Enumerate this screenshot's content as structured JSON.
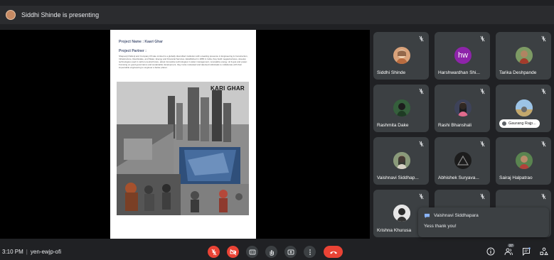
{
  "presenter_bar": {
    "text": "Siddhi Shinde is presenting"
  },
  "document": {
    "project_name": "Project Name : Kaari Ghar",
    "project_partner_heading": "Project Partner :",
    "body_text": "Shapoorji Pallonji and Company Private Limited is a globally diversified institution with a leading presence in Engineering & Construction, Infrastructure, Real Estate, and Water, Energy and Financial Services. Established in 1865 in India, they build megastructures, develop technologies used in carbon-neutral future, adopt innovative technologies in water management, renewable energy, oil & gas and power. Focusing on good governance and sustainable development, they invite motivated and talented individuals to collaborate with their impeccable engineering to engineer a better planet.",
    "collage_title": "KARI GHAR"
  },
  "participants": [
    {
      "name": "Siddhi Shinde",
      "avatar": "photo"
    },
    {
      "name": "Harshwardhan Shi...",
      "avatar": "initials",
      "initials": "hw"
    },
    {
      "name": "Tarika Deshpande",
      "avatar": "photo"
    },
    {
      "name": "Rashmita Dake",
      "avatar": "photo"
    },
    {
      "name": "Rashi Bhanshali",
      "avatar": "photo"
    },
    {
      "name": "Gaurang Rajp...",
      "avatar": "photo"
    },
    {
      "name": "Vaishnavi Siddhap...",
      "avatar": "photo"
    },
    {
      "name": "Abhishek Suryava...",
      "avatar": "icon"
    },
    {
      "name": "Sairaj Halpatrao",
      "avatar": "photo"
    },
    {
      "name": "Krishna Khurusa",
      "avatar": "photo"
    }
  ],
  "chat_toast": {
    "sender": "Vaishnavi Siddhapara",
    "message": "Yess thank you!"
  },
  "bottom_bar": {
    "time": "3:10 PM",
    "separator": "|",
    "meeting_code": "yen-ewjp-ofi",
    "participant_count": "27"
  },
  "colors": {
    "accent_red": "#ea4335",
    "hw_avatar": "#8e24aa",
    "tile_bg": "#3c4043",
    "background": "#202124"
  },
  "icons": [
    "mic-off-icon",
    "camera-off-icon",
    "captions-icon",
    "raise-hand-icon",
    "present-icon",
    "more-options-icon",
    "end-call-icon",
    "info-icon",
    "people-icon",
    "chat-icon",
    "activities-icon",
    "chat-bubble-icon"
  ]
}
